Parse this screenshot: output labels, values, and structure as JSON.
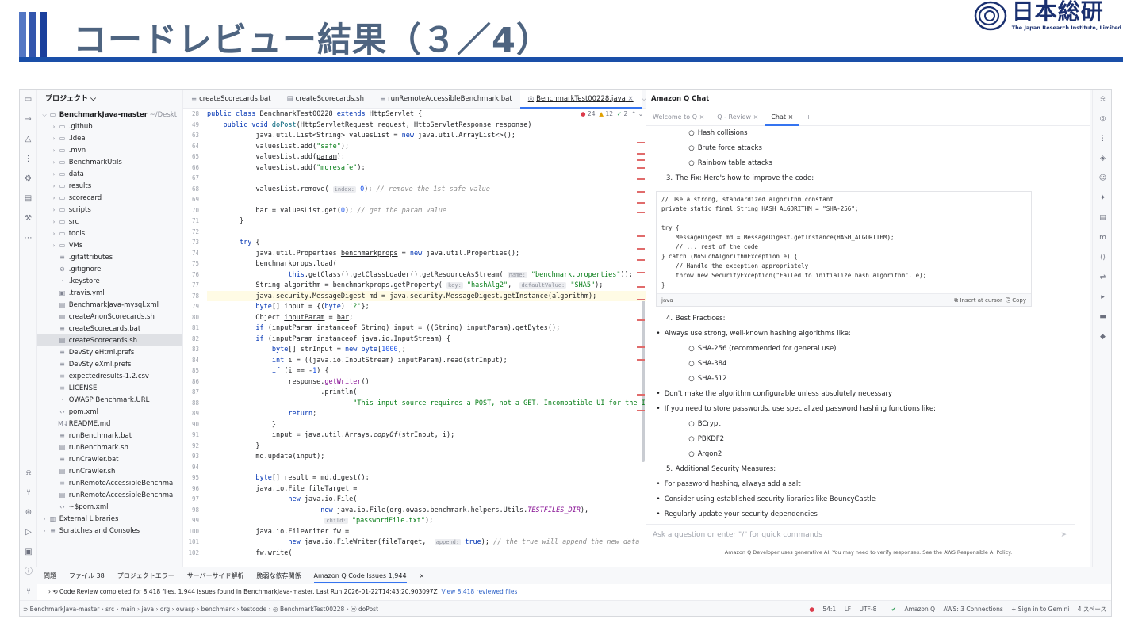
{
  "slide": {
    "title": "コードレビュー結果（３／4）",
    "logo_jp": "日本総研",
    "logo_en": "The Japan Research Institute, Limited"
  },
  "colors": {
    "accent": "#1a4fa8",
    "title": "#4e6480",
    "tab_active": "#3574f0"
  },
  "activity_icons": [
    "folder-icon",
    "commit-icon",
    "alert-icon",
    "structure-icon",
    "plugins-icon",
    "database-icon",
    "build-icon",
    "more-icon"
  ],
  "activity_icons_low": [
    "notifications-icon",
    "git-icon",
    "services-icon",
    "run-icon",
    "terminal-icon",
    "problems-icon",
    "version-control-icon"
  ],
  "project": {
    "header": "プロジェクト ⌵",
    "items": [
      {
        "indent": 0,
        "chev": "⌵",
        "icon": "▭",
        "label": "BenchmarkJava-master",
        "extra": " ~/Deskt",
        "bold": true
      },
      {
        "indent": 1,
        "chev": "›",
        "icon": "▭",
        "label": ".github"
      },
      {
        "indent": 1,
        "chev": "›",
        "icon": "▭",
        "label": ".idea"
      },
      {
        "indent": 1,
        "chev": "›",
        "icon": "▭",
        "label": ".mvn"
      },
      {
        "indent": 1,
        "chev": "›",
        "icon": "▭",
        "label": "BenchmarkUtils"
      },
      {
        "indent": 1,
        "chev": "›",
        "icon": "▭",
        "label": "data"
      },
      {
        "indent": 1,
        "chev": "›",
        "icon": "▭",
        "label": "results"
      },
      {
        "indent": 1,
        "chev": "›",
        "icon": "▭",
        "label": "scorecard"
      },
      {
        "indent": 1,
        "chev": "›",
        "icon": "▭",
        "label": "scripts"
      },
      {
        "indent": 1,
        "chev": "›",
        "icon": "▭",
        "label": "src"
      },
      {
        "indent": 1,
        "chev": "›",
        "icon": "▭",
        "label": "tools"
      },
      {
        "indent": 1,
        "chev": "›",
        "icon": "▭",
        "label": "VMs"
      },
      {
        "indent": 1,
        "chev": "",
        "icon": "≡",
        "label": ".gitattributes"
      },
      {
        "indent": 1,
        "chev": "",
        "icon": "⊘",
        "label": ".gitignore"
      },
      {
        "indent": 1,
        "chev": "",
        "icon": "·",
        "label": ".keystore"
      },
      {
        "indent": 1,
        "chev": "",
        "icon": "▣",
        "label": ".travis.yml"
      },
      {
        "indent": 1,
        "chev": "",
        "icon": "▤",
        "label": "BenchmarkJava-mysql.xml"
      },
      {
        "indent": 1,
        "chev": "",
        "icon": "▤",
        "label": "createAnonScorecards.sh"
      },
      {
        "indent": 1,
        "chev": "",
        "icon": "≡",
        "label": "createScorecards.bat"
      },
      {
        "indent": 1,
        "chev": "",
        "icon": "▤",
        "label": "createScorecards.sh",
        "selected": true
      },
      {
        "indent": 1,
        "chev": "",
        "icon": "≡",
        "label": "DevStyleHtml.prefs"
      },
      {
        "indent": 1,
        "chev": "",
        "icon": "≡",
        "label": "DevStyleXml.prefs"
      },
      {
        "indent": 1,
        "chev": "",
        "icon": "≡",
        "label": "expectedresults-1.2.csv"
      },
      {
        "indent": 1,
        "chev": "",
        "icon": "≡",
        "label": "LICENSE"
      },
      {
        "indent": 1,
        "chev": "",
        "icon": "·",
        "label": "OWASP Benchmark.URL"
      },
      {
        "indent": 1,
        "chev": "",
        "icon": "‹›",
        "label": "pom.xml"
      },
      {
        "indent": 1,
        "chev": "",
        "icon": "M↓",
        "label": "README.md"
      },
      {
        "indent": 1,
        "chev": "",
        "icon": "≡",
        "label": "runBenchmark.bat"
      },
      {
        "indent": 1,
        "chev": "",
        "icon": "▤",
        "label": "runBenchmark.sh"
      },
      {
        "indent": 1,
        "chev": "",
        "icon": "≡",
        "label": "runCrawler.bat"
      },
      {
        "indent": 1,
        "chev": "",
        "icon": "▤",
        "label": "runCrawler.sh"
      },
      {
        "indent": 1,
        "chev": "",
        "icon": "≡",
        "label": "runRemoteAccessibleBenchma"
      },
      {
        "indent": 1,
        "chev": "",
        "icon": "▤",
        "label": "runRemoteAccessibleBenchma"
      },
      {
        "indent": 1,
        "chev": "",
        "icon": "‹›",
        "label": "~$pom.xml"
      },
      {
        "indent": 0,
        "chev": "›",
        "icon": "▥",
        "label": "External Libraries"
      },
      {
        "indent": 0,
        "chev": "›",
        "icon": "≡",
        "label": "Scratches and Consoles"
      }
    ]
  },
  "editor": {
    "tabs": [
      {
        "icon": "≡",
        "label": "createScorecards.bat"
      },
      {
        "icon": "▤",
        "label": "createScorecards.sh"
      },
      {
        "icon": "≡",
        "label": "runRemoteAccessibleBenchmark.bat"
      },
      {
        "icon": "◎",
        "label": "BenchmarkTest00228.java",
        "active": true
      }
    ],
    "inspect": {
      "errors": "24",
      "warnings": "12",
      "ok": "2"
    },
    "lines": [
      {
        "n": "28",
        "h": "<span class=\"kw\">public class</span> <u>BenchmarkTest00228</u> <span class=\"kw\">extends</span> HttpServlet {"
      },
      {
        "n": "49",
        "h": "    <span class=\"kw\">public void</span> <span class=\"fn\">doPost</span>(HttpServletRequest request, HttpServletResponse response)"
      },
      {
        "n": "63",
        "h": "            java.util.List&lt;String&gt; valuesList = <span class=\"kw\">new</span> java.util.ArrayList&lt;&gt;();"
      },
      {
        "n": "64",
        "h": "            valuesList.add(<span class=\"str\">\"safe\"</span>);"
      },
      {
        "n": "65",
        "h": "            valuesList.add(<u>param</u>);"
      },
      {
        "n": "66",
        "h": "            valuesList.add(<span class=\"str\">\"moresafe\"</span>);"
      },
      {
        "n": "67",
        "h": ""
      },
      {
        "n": "68",
        "h": "            valuesList.remove( <span class=\"hint\">index:</span> <span class=\"num\">0</span>); <span class=\"cm\">// remove the 1st safe value</span>"
      },
      {
        "n": "69",
        "h": ""
      },
      {
        "n": "70",
        "h": "            bar = valuesList.get(<span class=\"num\">0</span>); <span class=\"cm\">// get the param value</span>"
      },
      {
        "n": "71",
        "h": "        }"
      },
      {
        "n": "72",
        "h": ""
      },
      {
        "n": "73",
        "h": "        <span class=\"kw\">try</span> {"
      },
      {
        "n": "74",
        "h": "            java.util.Properties <u>benchmarkprops</u> = <span class=\"kw\">new</span> java.util.Properties();"
      },
      {
        "n": "75",
        "h": "            benchmarkprops.load("
      },
      {
        "n": "76",
        "h": "                    <span class=\"kw\">this</span>.getClass().getClassLoader().getResourceAsStream( <span class=\"hint\">name:</span> <span class=\"str\">\"benchmark.properties\"</span>));"
      },
      {
        "n": "77",
        "h": "            String algorithm = benchmarkprops.getProperty( <span class=\"hint\">key:</span> <span class=\"str\">\"hashAlg2\"</span>,  <span class=\"hint\">defaultValue:</span> <span class=\"str\">\"SHA5\"</span>);"
      },
      {
        "n": "78",
        "h": "            java.security.MessageDigest md = java.security.MessageDigest.getInstance(algorithm);",
        "mark": true
      },
      {
        "n": "79",
        "h": "            <span class=\"kw\">byte</span>[] input = {(<span class=\"kw\">byte</span>) <span class=\"str\">'?'</span>};"
      },
      {
        "n": "80",
        "h": "            Object <u>inputParam</u> = <u>bar</u>;"
      },
      {
        "n": "81",
        "h": "            <span class=\"kw\">if</span> (<u>inputParam instanceof String</u>) input = ((String) inputParam).getBytes();"
      },
      {
        "n": "82",
        "h": "            <span class=\"kw\">if</span> (<u>inputParam instanceof java.io.InputStream</u>) {"
      },
      {
        "n": "83",
        "h": "                <span class=\"kw\">byte</span>[] strInput = <span class=\"kw\">new byte</span>[<span class=\"num\">1000</span>];"
      },
      {
        "n": "84",
        "h": "                <span class=\"kw\">int</span> i = ((java.io.InputStream) inputParam).read(strInput);"
      },
      {
        "n": "85",
        "h": "                <span class=\"kw\">if</span> (i == -<span class=\"num\">1</span>) {"
      },
      {
        "n": "86",
        "h": "                    response.<span class=\"fld\">getWriter</span>()"
      },
      {
        "n": "87",
        "h": "                            .println("
      },
      {
        "n": "88",
        "h": "                                    <span class=\"str\">\"This input source requires a POST, not a GET. Incompatible UI for the InputSt</span>"
      },
      {
        "n": "89",
        "h": "                    <span class=\"kw\">return</span>;"
      },
      {
        "n": "90",
        "h": "                }"
      },
      {
        "n": "91",
        "h": "                <u>input</u> = java.util.Arrays.<i>copyOf</i>(strInput, i);"
      },
      {
        "n": "92",
        "h": "            }"
      },
      {
        "n": "93",
        "h": "            md.update(input);"
      },
      {
        "n": "94",
        "h": ""
      },
      {
        "n": "95",
        "h": "            <span class=\"kw\">byte</span>[] result = md.digest();"
      },
      {
        "n": "96",
        "h": "            java.io.File fileTarget ="
      },
      {
        "n": "97",
        "h": "                    <span class=\"kw\">new</span> java.io.File("
      },
      {
        "n": "98",
        "h": "                            <span class=\"kw\">new</span> java.io.File(org.owasp.benchmark.helpers.Utils.<span class=\"fld\"><i>TESTFILES_DIR</i></span>),"
      },
      {
        "n": "99",
        "h": "                             <span class=\"hint\">child:</span> <span class=\"str\">\"passwordFile.txt\"</span>);"
      },
      {
        "n": "100",
        "h": "            java.io.FileWriter fw ="
      },
      {
        "n": "101",
        "h": "                    <span class=\"kw\">new</span> java.io.FileWriter(fileTarget,  <span class=\"hint\">append:</span> <span class=\"kw\">true</span>); <span class=\"cm\">// the true will append the new data</span>"
      },
      {
        "n": "102",
        "h": "            fw.write("
      }
    ]
  },
  "amazonq": {
    "title": "Amazon Q Chat",
    "tabs": [
      {
        "label": "Welcome to Q",
        "close": "×"
      },
      {
        "label": "Q - Review",
        "close": "×"
      },
      {
        "label": "Chat",
        "close": "×",
        "active": true
      }
    ],
    "add_tab": "+",
    "list_a": [
      {
        "level": 2,
        "bullet": "○",
        "text": "Hash collisions"
      },
      {
        "level": 2,
        "bullet": "○",
        "text": "Brute force attacks"
      },
      {
        "level": 2,
        "bullet": "○",
        "text": "Rainbow table attacks"
      },
      {
        "level": 1,
        "bullet": "3.",
        "text": "The Fix: Here's how to improve the code:"
      }
    ],
    "code_block": "// Use a strong, standardized algorithm constant\nprivate static final String HASH_ALGORITHM = \"SHA-256\";\n\ntry {\n    MessageDigest md = MessageDigest.getInstance(HASH_ALGORITHM);\n    // ... rest of the code\n} catch (NoSuchAlgorithmException e) {\n    // Handle the exception appropriately\n    throw new SecurityException(\"Failed to initialize hash algorithm\", e);\n}",
    "code_lang": "java",
    "insert_label": "Insert at cursor",
    "copy_label": "Copy",
    "list_b": [
      {
        "level": 1,
        "bullet": "4.",
        "text": "Best Practices:"
      },
      {
        "level": 0,
        "bullet": "•",
        "text": "Always use strong, well-known hashing algorithms like:"
      },
      {
        "level": 2,
        "bullet": "○",
        "text": "SHA-256 (recommended for general use)"
      },
      {
        "level": 2,
        "bullet": "○",
        "text": "SHA-384"
      },
      {
        "level": 2,
        "bullet": "○",
        "text": "SHA-512"
      },
      {
        "level": 0,
        "bullet": "•",
        "text": "Don't make the algorithm configurable unless absolutely necessary"
      },
      {
        "level": 0,
        "bullet": "•",
        "text": "If you need to store passwords, use specialized password hashing functions like:"
      },
      {
        "level": 2,
        "bullet": "○",
        "text": "BCrypt"
      },
      {
        "level": 2,
        "bullet": "○",
        "text": "PBKDF2"
      },
      {
        "level": 2,
        "bullet": "○",
        "text": "Argon2"
      },
      {
        "level": 1,
        "bullet": "5.",
        "text": "Additional Security Measures:"
      },
      {
        "level": 0,
        "bullet": "•",
        "text": "For password hashing, always add a salt"
      },
      {
        "level": 0,
        "bullet": "•",
        "text": "Consider using established security libraries like BouncyCastle"
      },
      {
        "level": 0,
        "bullet": "•",
        "text": "Regularly update your security dependencies"
      }
    ],
    "input_placeholder": "Ask a question or enter \"/\" for quick commands",
    "footer": "Amazon Q Developer uses generative AI. You may need to verify responses. See the AWS Responsible AI Policy."
  },
  "right_icons": [
    "notifications-icon",
    "ai-assistant-icon",
    "structure-icon",
    "amazon-q-icon",
    "copilot-icon",
    "gemini-icon",
    "database-icon",
    "maven-icon",
    "code-icon",
    "endpoints-icon",
    "gradle-icon",
    "db-icon",
    "diamond-icon"
  ],
  "bottom": {
    "tabs": [
      {
        "label": "問題"
      },
      {
        "label": "ファイル 38"
      },
      {
        "label": "プロジェクトエラー"
      },
      {
        "label": "サーバーサイド解析"
      },
      {
        "label": "脆弱な依存関係"
      },
      {
        "label": "Amazon Q Code Issues 1,944",
        "active": true
      },
      {
        "label": "×"
      }
    ],
    "output_prefix": "›  ⟲ Code Review completed for 8,418 files. 1,944 issues found in BenchmarkJava-master. Last Run 2026-01-22T14:43:20.903097Z",
    "output_link": "View 8,418 reviewed files"
  },
  "status": {
    "breadcrumb": "⊃ BenchmarkJava-master  ›  src  ›  main  ›  java  ›  org  ›  owasp  ›  benchmark  ›  testcode  ›  ◎ BenchmarkTest00228  ›  ⓜ doPost",
    "position": "54:1",
    "line_sep": "LF",
    "encoding": "UTF-8",
    "amazonq": "Amazon Q",
    "aws": "AWS: 3 Connections",
    "gemini": "+ Sign in to Gemini",
    "indent": "4 スペース"
  }
}
